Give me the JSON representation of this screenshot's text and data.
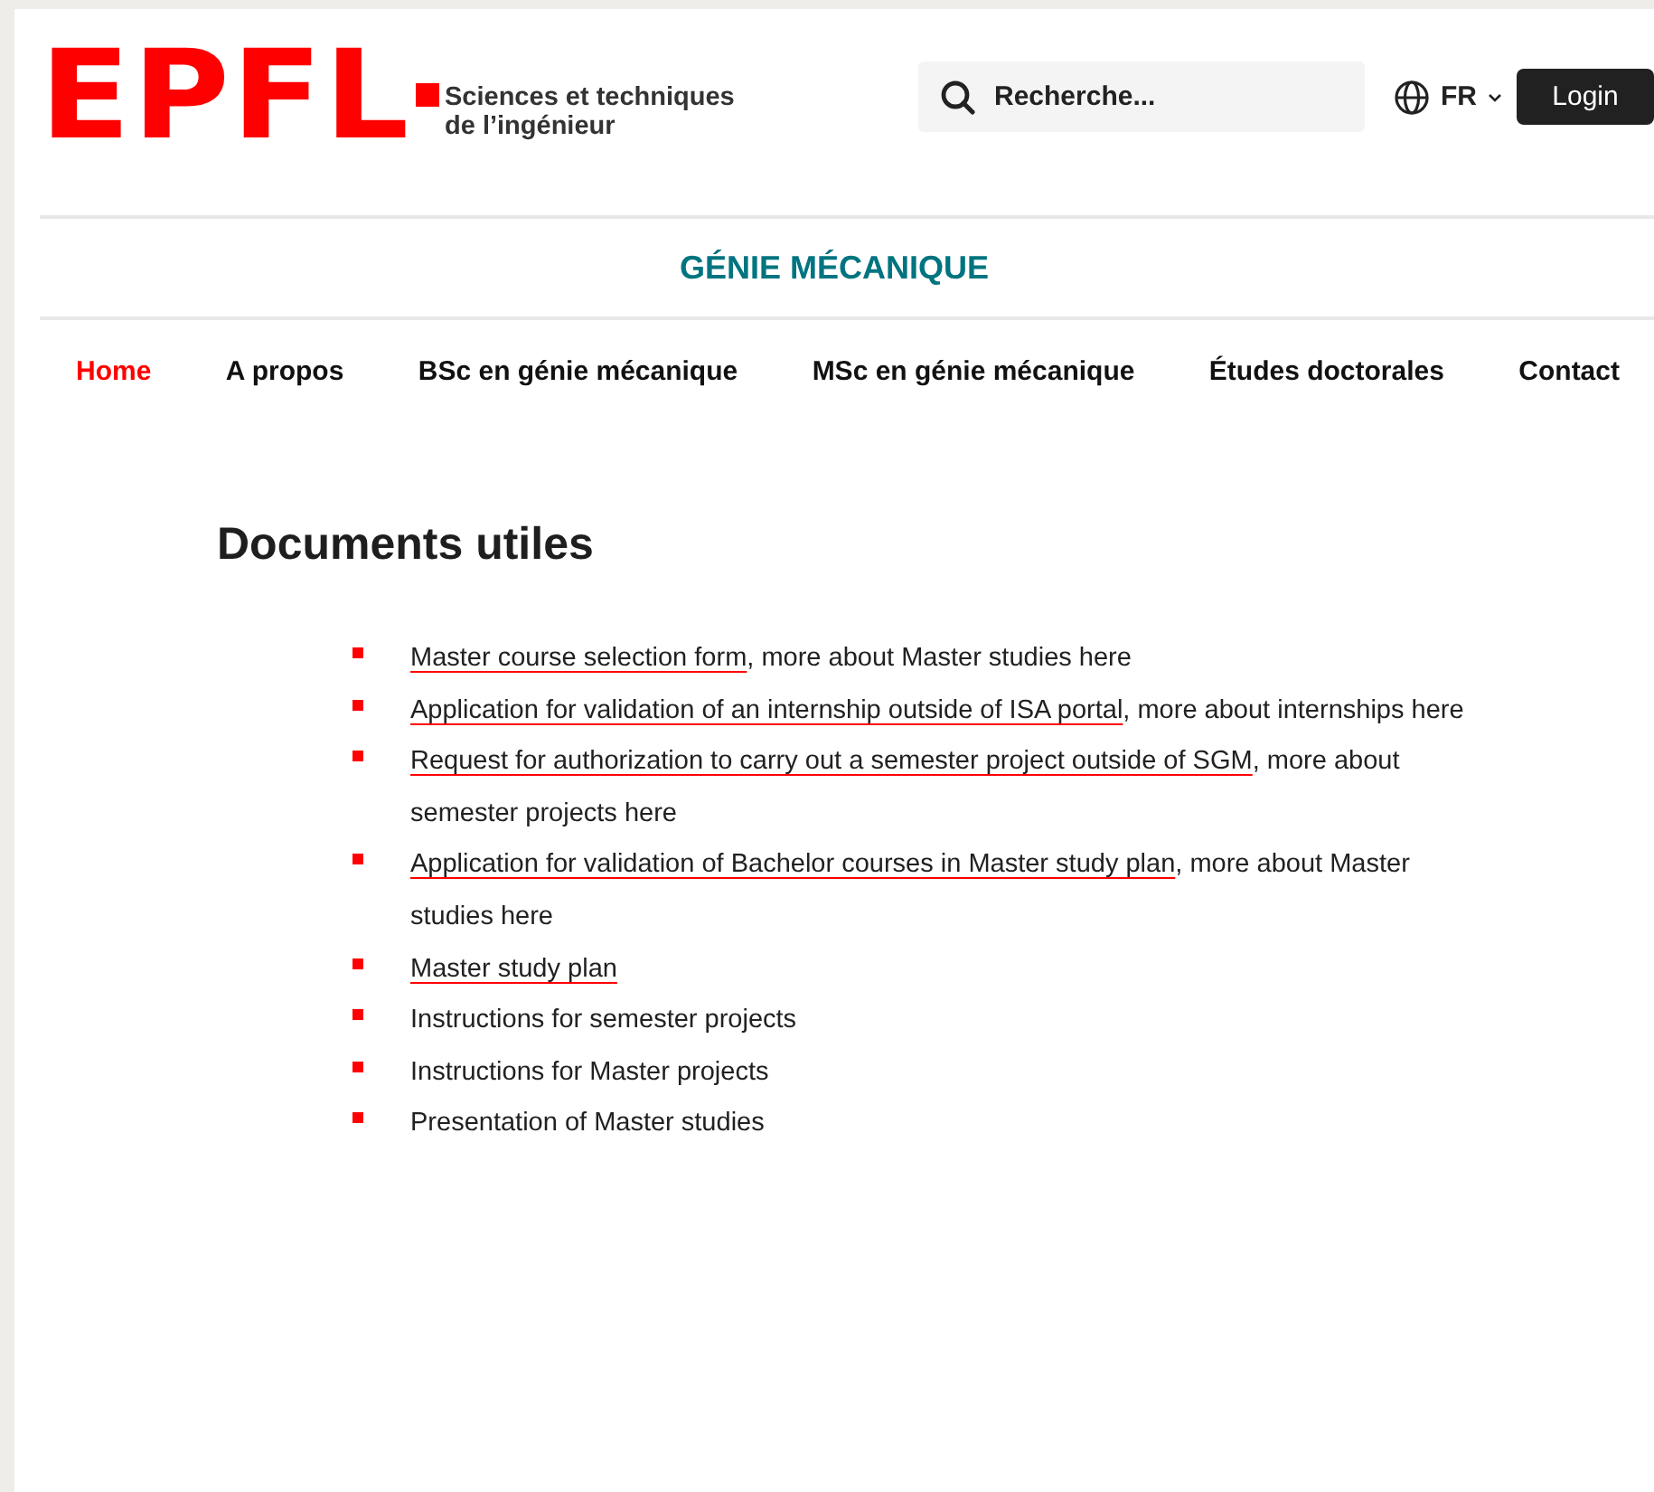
{
  "header": {
    "logo": "EPFL",
    "tagline": [
      "Sciences et techniques",
      "de l’ingénieur"
    ],
    "search": {
      "placeholder": "Recherche..."
    },
    "language": "FR",
    "login": "Login"
  },
  "site_title": "GÉNIE MÉCANIQUE",
  "nav": [
    {
      "label": "Home",
      "selected": true
    },
    {
      "label": "A propos",
      "selected": false
    },
    {
      "label": "BSc en génie mécanique",
      "selected": false
    },
    {
      "label": "MSc en génie mécanique",
      "selected": false
    },
    {
      "label": "Études doctorales",
      "selected": false
    },
    {
      "label": "Contact",
      "selected": false
    }
  ],
  "heading": "Documents utiles",
  "documents": [
    {
      "link": "Master course selection form",
      "text": ", more about Master studies here"
    },
    {
      "link": "Application for validation of an internship outside of ISA portal",
      "text": ", more about internships here"
    },
    {
      "link": "Request for authorization to carry out a semester project outside of SGM",
      "text": ", more about semester projects here"
    },
    {
      "link": "Application for validation of Bachelor courses in Master study plan",
      "text": ", more about Master studies here"
    },
    {
      "link": "Master study plan"
    },
    {
      "text": "Instructions for semester projects"
    },
    {
      "text": "Instructions for Master projects"
    },
    {
      "text": "Presentation of Master studies"
    }
  ]
}
